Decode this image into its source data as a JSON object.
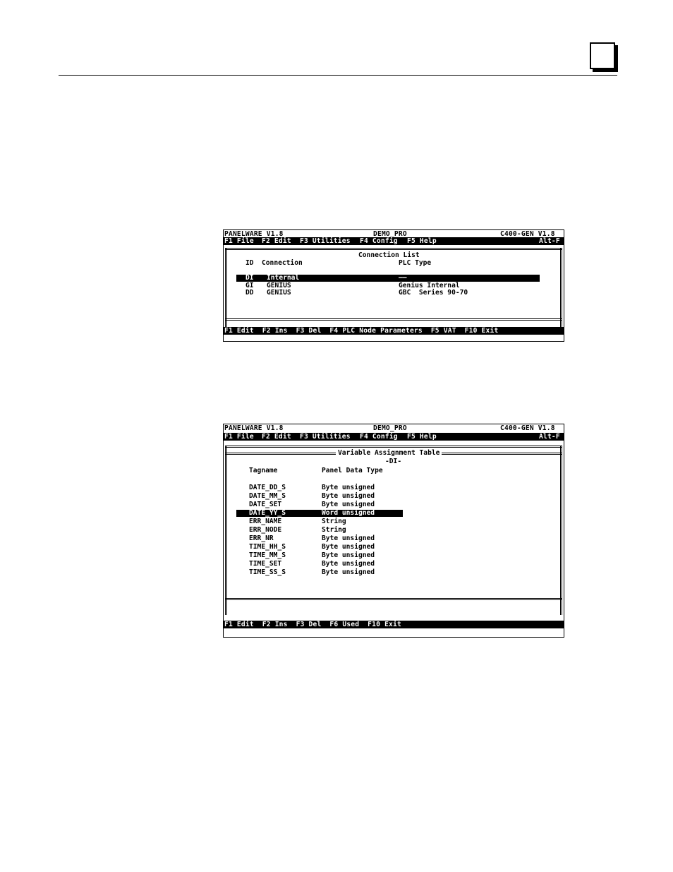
{
  "page": {
    "corner_box": ""
  },
  "screen1": {
    "status_bar": {
      "app": "PANELWARE V1.8",
      "project": "DEMO_PRO",
      "target": "C400-GEN V1.8"
    },
    "menu_bar": {
      "items": [
        "F1 File",
        "F2 Edit",
        "F3 Utilities",
        "F4 Config",
        "F5 Help"
      ],
      "hotkey": "Alt-F"
    },
    "panel_title": "Connection List",
    "columns": {
      "id": "ID",
      "connection": "Connection",
      "plc_type": "PLC Type"
    },
    "rows": [
      {
        "id": "DI",
        "connection": "Internal",
        "plc_type": "——",
        "selected": true
      },
      {
        "id": "GI",
        "connection": "GENIUS",
        "plc_type": "Genius Internal",
        "selected": false
      },
      {
        "id": "DD",
        "connection": "GENIUS",
        "plc_type": "GBC  Series 90-70",
        "selected": false
      }
    ],
    "function_bar": "F1 Edit  F2 Ins  F3 Del  F4 PLC Node Parameters  F5 VAT  F10 Exit"
  },
  "screen2": {
    "status_bar": {
      "app": "PANELWARE V1.8",
      "project": "DEMO_PRO",
      "target": "C400-GEN V1.8"
    },
    "menu_bar": {
      "items": [
        "F1 File",
        "F2 Edit",
        "F3 Utilities",
        "F4 Config",
        "F5 Help"
      ],
      "hotkey": "Alt-F"
    },
    "panel_title": "Variable Assignment Table",
    "panel_subtitle": "-DI-",
    "columns": {
      "tagname": "Tagname",
      "type": "Panel Data Type"
    },
    "rows": [
      {
        "tag": "DATE_DD_S",
        "type": "Byte unsigned",
        "selected": false
      },
      {
        "tag": "DATE_MM_S",
        "type": "Byte unsigned",
        "selected": false
      },
      {
        "tag": "DATE_SET",
        "type": "Byte unsigned",
        "selected": false
      },
      {
        "tag": "DATE_YY_S",
        "type": "Word unsigned",
        "selected": true
      },
      {
        "tag": "ERR_NAME",
        "type": "String",
        "selected": false
      },
      {
        "tag": "ERR_NODE",
        "type": "String",
        "selected": false
      },
      {
        "tag": "ERR_NR",
        "type": "Byte unsigned",
        "selected": false
      },
      {
        "tag": "TIME_HH_S",
        "type": "Byte unsigned",
        "selected": false
      },
      {
        "tag": "TIME_MM_S",
        "type": "Byte unsigned",
        "selected": false
      },
      {
        "tag": "TIME_SET",
        "type": "Byte unsigned",
        "selected": false
      },
      {
        "tag": "TIME_SS_S",
        "type": "Byte unsigned",
        "selected": false
      }
    ],
    "function_bar": "F1 Edit  F2 Ins  F3 Del  F6 Used  F10 Exit"
  }
}
